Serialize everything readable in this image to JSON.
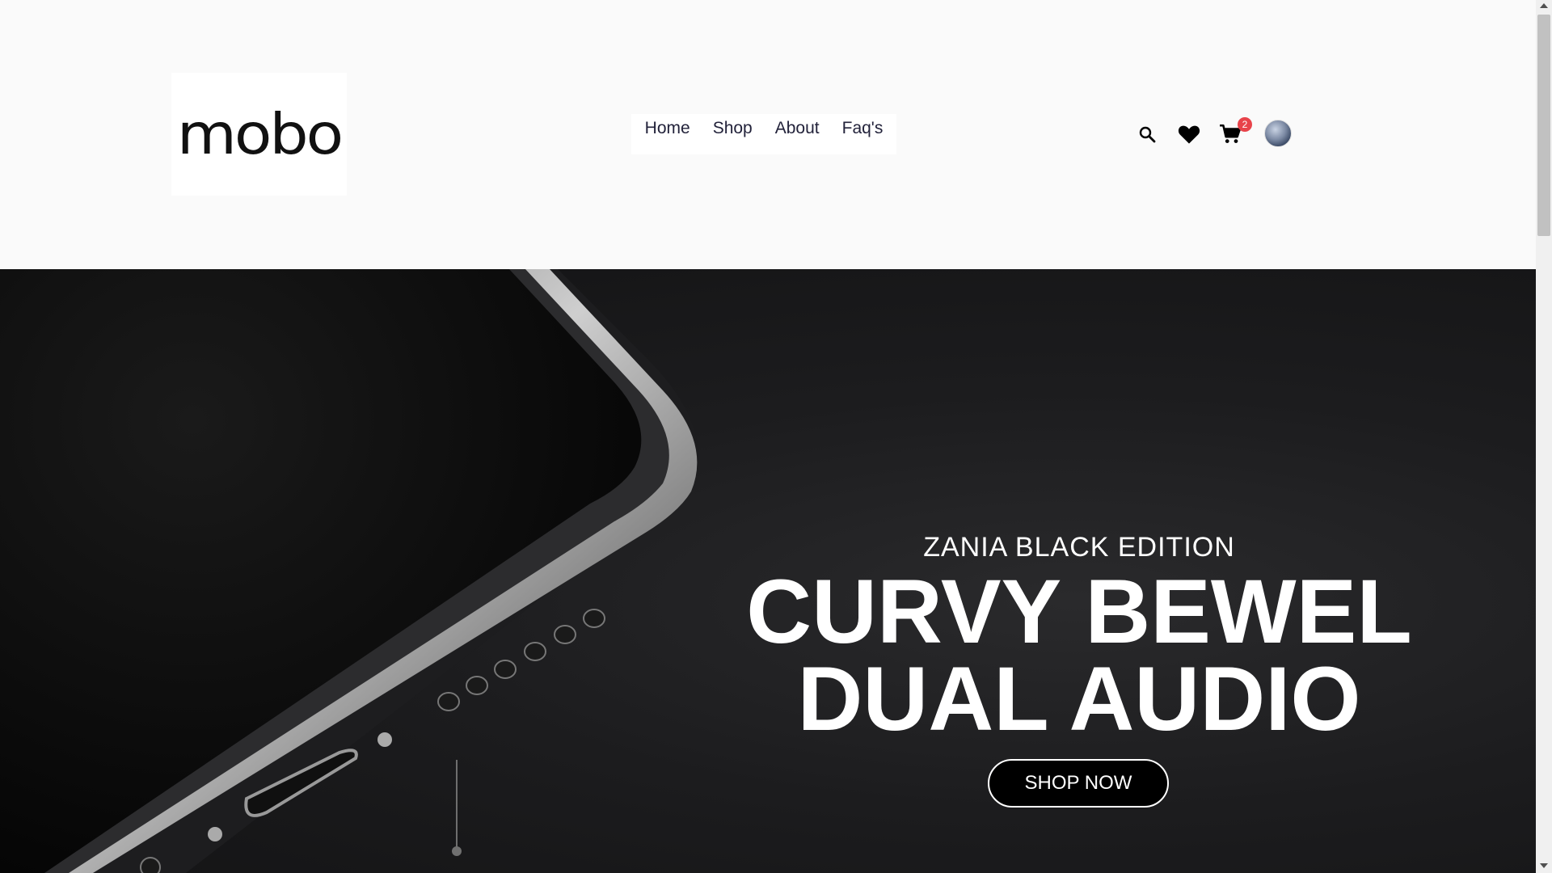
{
  "brand": {
    "logo_text": "mobo"
  },
  "nav": {
    "items": [
      {
        "label": "Home"
      },
      {
        "label": "Shop"
      },
      {
        "label": "About"
      },
      {
        "label": "Faq's"
      }
    ]
  },
  "header_icons": {
    "search_icon": "search-icon",
    "wishlist_icon": "heart-icon",
    "cart_icon": "cart-icon",
    "cart_count": "2",
    "avatar": "user-avatar"
  },
  "hero": {
    "subtitle": "ZANIA BLACK EDITION",
    "title_line1": "CURVY BEWEL",
    "title_line2": "DUAL AUDIO",
    "cta_label": "SHOP NOW"
  },
  "colors": {
    "badge": "#e8434a",
    "hero_bg": "#1c1c1e",
    "header_bg": "#fafafa"
  }
}
